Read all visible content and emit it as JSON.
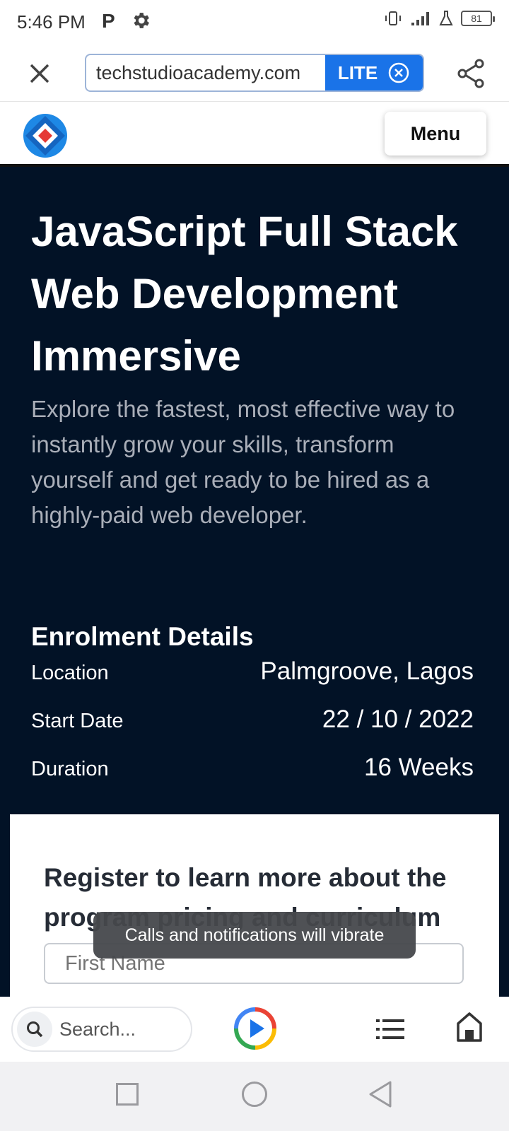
{
  "status_bar": {
    "time": "5:46 PM",
    "p_badge": "P",
    "battery": "81"
  },
  "browser": {
    "url": "techstudioacademy.com",
    "lite_label": "LITE"
  },
  "site_header": {
    "menu_label": "Menu"
  },
  "hero": {
    "title": "JavaScript Full Stack Web Development Immersive",
    "description": "Explore the fastest, most effective way to instantly grow your skills, transform yourself and get ready to be hired as a highly-paid web developer."
  },
  "enrolment": {
    "title": "Enrolment Details",
    "rows": [
      {
        "label": "Location",
        "value": "Palmgroove, Lagos"
      },
      {
        "label": "Start Date",
        "value": "22 / 10 / 2022"
      },
      {
        "label": "Duration",
        "value": "16 Weeks"
      }
    ]
  },
  "register": {
    "title": "Register to learn more about the program pricing and curriculum",
    "first_name_placeholder": "First Name"
  },
  "toast": {
    "message": "Calls and notifications will vibrate"
  },
  "bottom_bar": {
    "search_placeholder": "Search..."
  },
  "colors": {
    "hero_bg": "#021226",
    "accent": "#1a73e8"
  }
}
